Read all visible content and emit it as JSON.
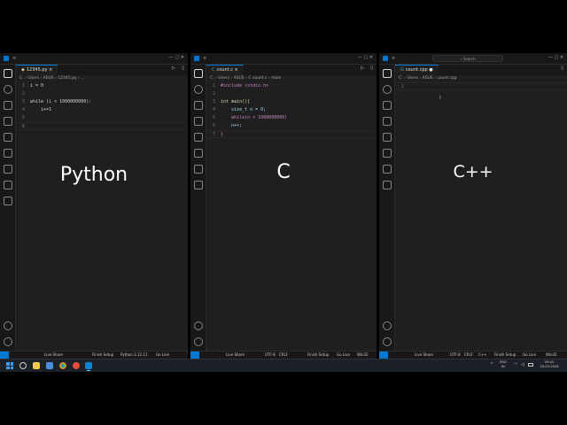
{
  "python_window": {
    "tab": "12345.py",
    "breadcrumb": "C: › Users › ASUS › 12345.py › ...",
    "lines": [
      {
        "n": "1",
        "code": "i = 0"
      },
      {
        "n": "2",
        "code": ""
      },
      {
        "n": "3",
        "code": "while (i < 1000000000):"
      },
      {
        "n": "4",
        "code": "    i+=1"
      },
      {
        "n": "5",
        "code": ""
      },
      {
        "n": "6",
        "code": ""
      }
    ],
    "label": "Python",
    "status": {
      "live_share": "Live Share",
      "finish_setup": "Finish Setup",
      "python": "Python 3.12.11",
      "go_live": "Go Live"
    }
  },
  "c_window": {
    "tab": "count.c",
    "breadcrumb": "C: › Users › ASUS › C count.c › main",
    "lines": [
      {
        "n": "1",
        "code": "#include <stdio.h>"
      },
      {
        "n": "2",
        "code": ""
      },
      {
        "n": "3",
        "code": "int main(){"
      },
      {
        "n": "4",
        "code": "    size_t n = 0;"
      },
      {
        "n": "5",
        "code": "    while(n < 1000000000)"
      },
      {
        "n": "6",
        "code": "    n++;"
      },
      {
        "n": "7",
        "code": "}"
      }
    ],
    "label": "C",
    "status": {
      "live_share": "Live Share",
      "utf": "UTF-8",
      "crlf": "CRLF",
      "finish_setup": "Finish Setup",
      "go_live": "Go Live",
      "win32": "Win32"
    }
  },
  "cpp_window": {
    "tab": "count.cpp",
    "search": "Search",
    "breadcrumb": "C: › Users › ASUS › count.cpp",
    "lines": [
      {
        "n": "1",
        "code": ""
      }
    ],
    "label": "C++",
    "status": {
      "live_share": "Live Share",
      "utf": "UTF-8",
      "crlf": "CRLF",
      "lang": "C++",
      "finish_setup": "Finish Setup",
      "go_live": "Go Live",
      "win32": "Win32"
    }
  },
  "taskbar": {
    "lang_line1": "ENG",
    "lang_line2": "IN",
    "time": "09:41",
    "date": "20-03-2026"
  },
  "colors": {
    "accent": "#0078d4",
    "editor_bg": "#1f1f1f",
    "chrome_bg": "#181818"
  }
}
